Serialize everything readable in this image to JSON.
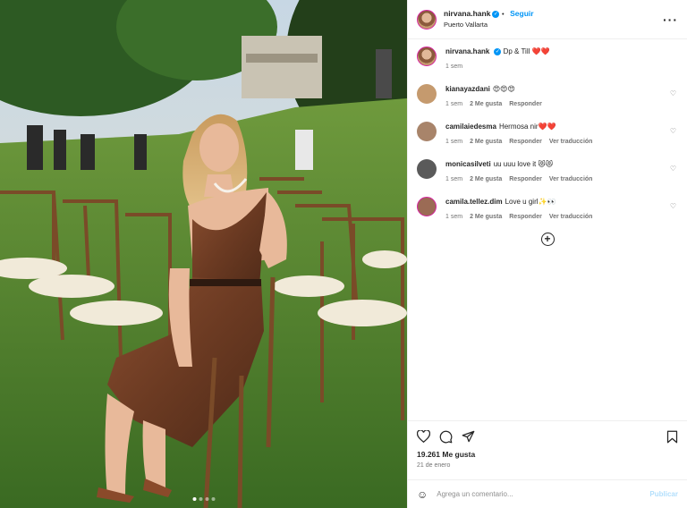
{
  "post": {
    "username": "nirvana.hank",
    "follow_label": "Seguir",
    "location": "Puerto Vallarta",
    "more_icon": "more-options-icon",
    "caption_username": "nirvana.hank",
    "caption_text": "Dp & Till ❤️❤️",
    "caption_time": "1 sem"
  },
  "comments": [
    {
      "username": "kianayazdani",
      "text": "😍😍😍",
      "time": "1 sem",
      "likes": "2 Me gusta",
      "reply": "Responder",
      "translate": "",
      "avatar_color": "#c59a6e"
    },
    {
      "username": "camilaiedesma",
      "text": "Hermosa nir❤️❤️",
      "time": "1 sem",
      "likes": "2 Me gusta",
      "reply": "Responder",
      "translate": "Ver traducción",
      "avatar_color": "#a8846a"
    },
    {
      "username": "monicasilveti",
      "text": "uu uuu love it 😻😻",
      "time": "1 sem",
      "likes": "2 Me gusta",
      "reply": "Responder",
      "translate": "Ver traducción",
      "avatar_color": "#5a5a5a"
    },
    {
      "username": "camila.tellez.dim",
      "text": "Love u girl✨👀",
      "time": "1 sem",
      "likes": "2 Me gusta",
      "reply": "Responder",
      "translate": "Ver traducción",
      "avatar_color": "#9b6b55"
    }
  ],
  "footer": {
    "likes": "19.261 Me gusta",
    "date": "21 de enero",
    "comment_placeholder": "Agrega un comentario...",
    "publish_label": "Publicar"
  },
  "colors": {
    "accent": "#0095f6",
    "text": "#262626",
    "muted": "#737373"
  }
}
